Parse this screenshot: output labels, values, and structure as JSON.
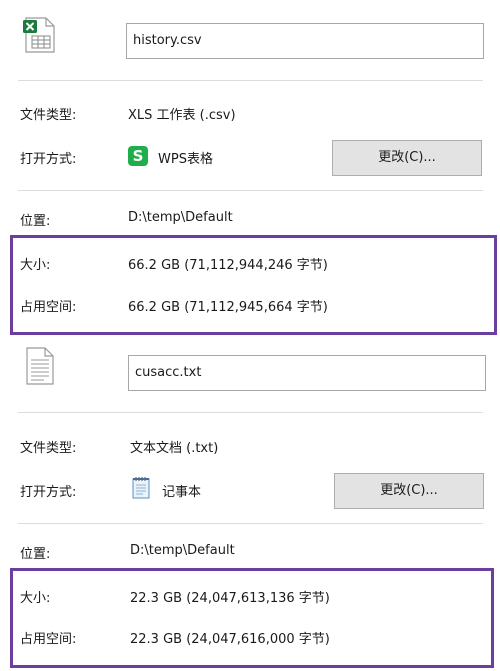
{
  "sections": [
    {
      "filename": "history.csv",
      "type_label": "文件类型:",
      "type_value": "XLS 工作表 (.csv)",
      "open_label": "打开方式:",
      "open_app": "WPS表格",
      "change_label": "更改(C)...",
      "location_label": "位置:",
      "location_value": "D:\\temp\\Default",
      "size_label": "大小:",
      "size_value": "66.2 GB (71,112,944,246 字节)",
      "disk_label": "占用空间:",
      "disk_value": "66.2 GB (71,112,945,664 字节)",
      "file_icon": "excel-csv-file-icon",
      "app_icon": "wps-spreadsheet-icon"
    },
    {
      "filename": "cusacc.txt",
      "type_label": "文件类型:",
      "type_value": "文本文档 (.txt)",
      "open_label": "打开方式:",
      "open_app": "记事本",
      "change_label": "更改(C)...",
      "location_label": "位置:",
      "location_value": "D:\\temp\\Default",
      "size_label": "大小:",
      "size_value": "22.3 GB (24,047,613,136 字节)",
      "disk_label": "占用空间:",
      "disk_value": "22.3 GB (24,047,616,000 字节)",
      "file_icon": "text-file-icon",
      "app_icon": "notepad-icon"
    }
  ],
  "icons": {
    "wps_letter": "S"
  },
  "colors": {
    "highlight": "#6a3fa0",
    "wps_green": "#1fae4b",
    "excel_green": "#1d7a3e"
  }
}
